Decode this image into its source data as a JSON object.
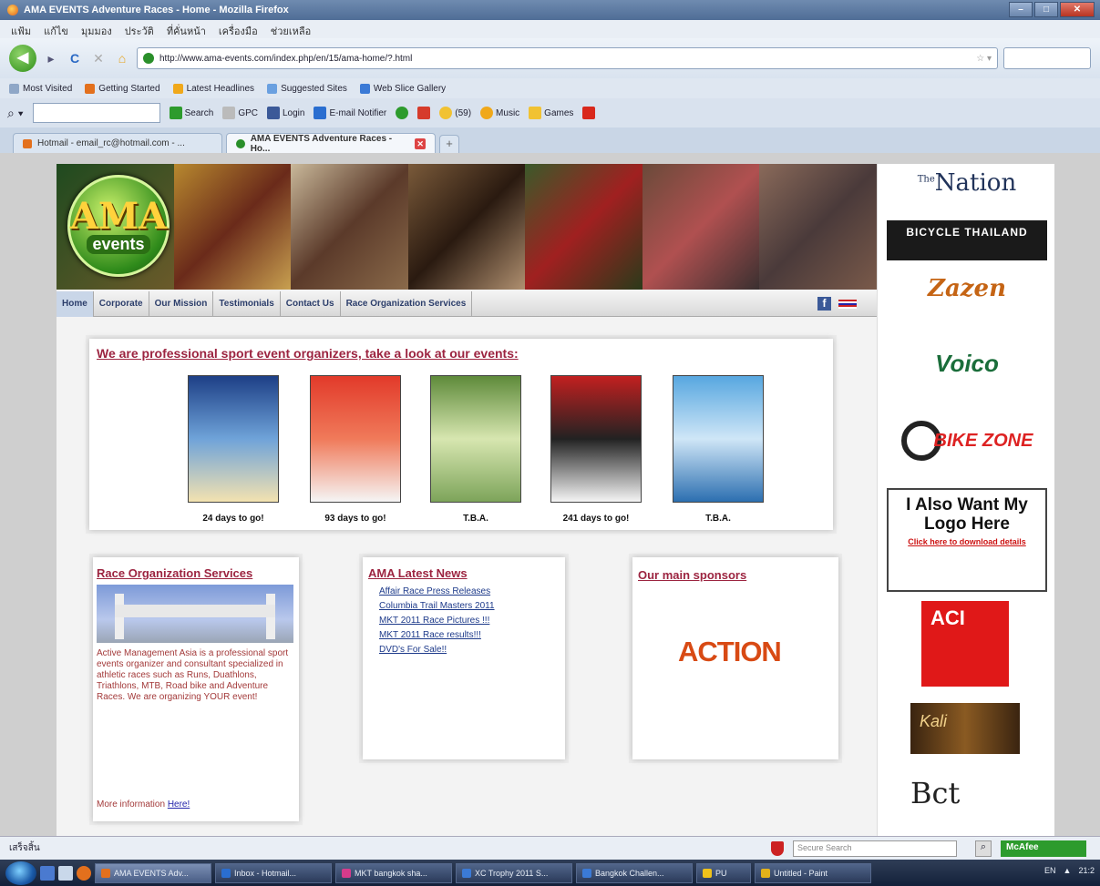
{
  "window": {
    "title": "AMA EVENTS Adventure Races - Home - Mozilla Firefox",
    "controls": [
      "–",
      "□",
      "✕"
    ]
  },
  "menubar": [
    "แฟ้ม",
    "แก้ไข",
    "มุมมอง",
    "ประวัติ",
    "ที่คั่นหน้า",
    "เครื่องมือ",
    "ช่วยเหลือ"
  ],
  "nav": {
    "url": "http://www.ama-events.com/index.php/en/15/ama-home/?.html",
    "search_placeholder": "",
    "icons": {
      "back": "back-arrow-icon",
      "forward": "forward-arrow-icon",
      "reload": "reload-icon",
      "stop": "stop-icon",
      "home": "home-icon"
    }
  },
  "bookmarks": [
    {
      "label": "Most Visited",
      "color": "#8fa7c7"
    },
    {
      "label": "Getting Started",
      "color": "#e3701d"
    },
    {
      "label": "Latest Headlines",
      "color": "#f0a81a"
    },
    {
      "label": "Suggested Sites",
      "color": "#6aa0e0"
    },
    {
      "label": "Web Slice Gallery",
      "color": "#3b7ad6"
    }
  ],
  "toolbar2": [
    {
      "label": "Search",
      "color": "#2d9b2d"
    },
    {
      "label": "GPC",
      "color": "#bbbbbb"
    },
    {
      "label": "Login",
      "color": "#3b5998"
    },
    {
      "label": "E-mail Notifier",
      "color": "#2a6ed0"
    },
    {
      "label": "",
      "color": "#2d9b2d"
    },
    {
      "label": "",
      "color": "#d63b2b"
    },
    {
      "label": "(59)",
      "color": "#f1c232"
    },
    {
      "label": "Music",
      "color": "#f0a81a"
    },
    {
      "label": "Games",
      "color": "#f1c232"
    },
    {
      "label": "",
      "color": "#d9281c"
    }
  ],
  "tabs": [
    {
      "label": "Hotmail - email_rc@hotmail.com - ...",
      "active": false
    },
    {
      "label": "AMA EVENTS Adventure Races - Ho...",
      "active": true
    }
  ],
  "site": {
    "logo": {
      "top": "AMA",
      "bottom": "events"
    },
    "nav": [
      "Home",
      "Corporate",
      "Our Mission",
      "Testimonials",
      "Contact Us",
      "Race Organization Services"
    ],
    "events_heading": "We are professional sport event organizers, take a look at our events:",
    "events": [
      {
        "label": "24 days to go!",
        "colors": [
          "#1d3f86",
          "#6fa3d9",
          "#f3e2b0"
        ]
      },
      {
        "label": "93 days to go!",
        "colors": [
          "#e23a2a",
          "#f07a5a",
          "#f5f5f5"
        ]
      },
      {
        "label": "T.B.A.",
        "colors": [
          "#5e8a3a",
          "#d7e6b0",
          "#7da45a"
        ]
      },
      {
        "label": "241 days to go!",
        "colors": [
          "#c22020",
          "#222222",
          "#f5f5f5"
        ]
      },
      {
        "label": "T.B.A.",
        "colors": [
          "#57a7e0",
          "#cfe6f7",
          "#2c6fb0"
        ]
      }
    ],
    "ros": {
      "title": "Race Organization Services",
      "text": "Active Management Asia is a professional sport events organizer and consultant specialized in athletic races such as Runs, Duathlons, Triathlons, MTB, Road bike and Adventure Races. We are organizing YOUR event!",
      "more_prefix": "More information",
      "more_link": "Here!"
    },
    "news": {
      "title": "AMA Latest News",
      "items": [
        "Affair Race Press Releases",
        "Columbia Trail Masters 2011",
        "MKT 2011 Race Pictures !!!",
        "MKT 2011 Race results!!!",
        "DVD's For Sale!!"
      ]
    },
    "sponsors": {
      "title": "Our main sponsors",
      "logo_text": "ACTION"
    }
  },
  "right_ads": {
    "nation": "Nation",
    "nation_prefix": "The",
    "bicycle": "BICYCLE THAILAND",
    "zazen": "Zazen",
    "voico": "Voico",
    "bikezone": "BIKE ZONE",
    "logo_big": "I Also Want My Logo Here",
    "logo_small": "Click here to download details",
    "aci": "ACI",
    "kali": "Kali",
    "bct": "Bct"
  },
  "statusbar": {
    "text": "เสร็จสิ้น",
    "search_placeholder": "Secure Search",
    "mcafee": "McAfee"
  },
  "taskbar": {
    "tasks": [
      {
        "label": "AMA EVENTS Adv...",
        "color": "#e3701d",
        "active": true
      },
      {
        "label": "Inbox - Hotmail...",
        "color": "#2a6ed0",
        "active": false
      },
      {
        "label": "MKT bangkok sha...",
        "color": "#d63b8b",
        "active": false
      },
      {
        "label": "XC Trophy 2011 S...",
        "color": "#3b7ad6",
        "active": false
      },
      {
        "label": "Bangkok Challen...",
        "color": "#3b7ad6",
        "active": false
      },
      {
        "label": "PU",
        "color": "#f0c21a",
        "active": false
      },
      {
        "label": "Untitled - Paint",
        "color": "#e3b21a",
        "active": false
      }
    ],
    "tray": [
      "EN",
      "▲",
      "21:2"
    ]
  }
}
